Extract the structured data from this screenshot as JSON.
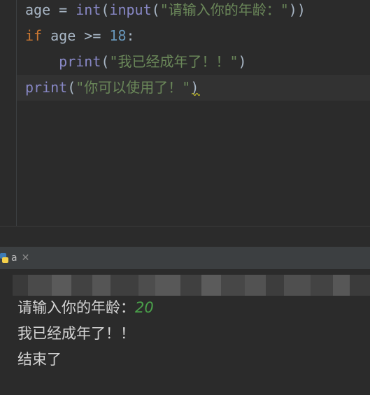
{
  "editor": {
    "lines": [
      {
        "t1": "age = ",
        "b1": "int",
        "p1": "(",
        "b2": "input",
        "p2": "(",
        "s": "\"请输入你的年龄：\"",
        "p3": "))"
      },
      {
        "kw": "if",
        "t1": " age >= ",
        "num": "18",
        "t2": ":"
      },
      {
        "indent": "    ",
        "b": "print",
        "p1": "(",
        "s": "\"我已经成年了！！\"",
        "p2": ")"
      },
      {
        "b": "print",
        "p1": "(",
        "s": "\"你可以使用了！\"",
        "p2": ")"
      }
    ]
  },
  "run_panel": {
    "tab_label": "a",
    "tab_icon": "python-icon",
    "close_icon": "close-icon"
  },
  "console": {
    "prompt": "请输入你的年龄：",
    "user_input": "20",
    "outputs": [
      "我已经成年了！！",
      "结束了"
    ]
  },
  "colors": {
    "background": "#2b2b2b",
    "keyword": "#cc7832",
    "number": "#6897bb",
    "builtin": "#8888c6",
    "string": "#6a8759",
    "console_input": "#4aa04a"
  }
}
